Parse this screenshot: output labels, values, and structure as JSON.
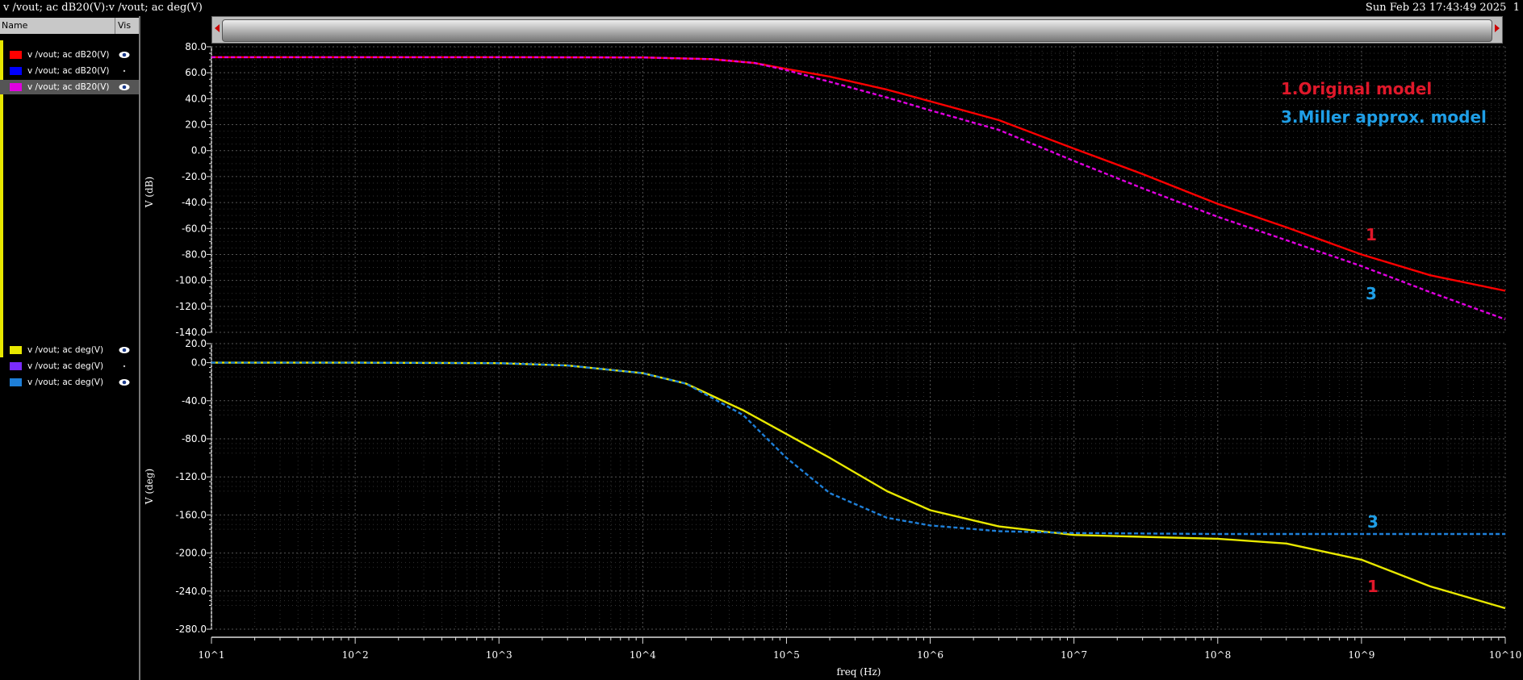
{
  "window": {
    "title": "v /vout; ac dB20(V):v /vout; ac deg(V)",
    "timestamp": "Sun Feb 23 17:43:49 2025",
    "window_number": "1"
  },
  "legend_pane": {
    "header_name": "Name",
    "header_vis": "Vis",
    "top_signals": [
      {
        "label": "v /vout; ac dB20(V)",
        "color": "#ff0000",
        "visible": true,
        "selected": false
      },
      {
        "label": "v /vout; ac dB20(V)",
        "color": "#0000ff",
        "visible": false,
        "selected": false
      },
      {
        "label": "v /vout; ac dB20(V)",
        "color": "#e000e0",
        "visible": true,
        "selected": true
      }
    ],
    "bottom_signals": [
      {
        "label": "v /vout; ac deg(V)",
        "color": "#e8e800",
        "visible": true,
        "selected": false
      },
      {
        "label": "v /vout; ac deg(V)",
        "color": "#7a2cff",
        "visible": false,
        "selected": false
      },
      {
        "label": "v /vout; ac deg(V)",
        "color": "#1e7fd8",
        "visible": true,
        "selected": false
      }
    ]
  },
  "annotations": {
    "legend_original": "1.Original model",
    "legend_miller": "3.Miller approx. model",
    "mag_label_1": "1",
    "mag_label_3": "3",
    "phase_label_3": "3",
    "phase_label_1": "1",
    "color_original": "#e0182a",
    "color_miller": "#1f9ee6"
  },
  "chart_data": [
    {
      "type": "line",
      "panel": "magnitude",
      "ylabel": "V (dB)",
      "xlabel": "freq (Hz)",
      "xscale": "log",
      "xlim": [
        10,
        10000000000
      ],
      "ylim": [
        -140,
        80
      ],
      "yticks": [
        "80.0",
        "60.0",
        "40.0",
        "20.0",
        "0.0",
        "-20.0",
        "-40.0",
        "-60.0",
        "-80.0",
        "-100.0",
        "-120.0",
        "-140.0"
      ],
      "grid": true,
      "series": [
        {
          "name": "1.Original model",
          "color": "#ff0000",
          "style": "solid",
          "x": [
            10,
            100,
            1000,
            10000,
            30000,
            60000,
            100000,
            200000,
            500000,
            1000000,
            3000000,
            10000000,
            30000000,
            100000000,
            300000000,
            1000000000,
            3000000000,
            10000000000
          ],
          "y": [
            72,
            72,
            72,
            71.8,
            70.5,
            67.5,
            63,
            57,
            47,
            38,
            23.5,
            1.5,
            -18,
            -41,
            -59,
            -80,
            -96,
            -108
          ]
        },
        {
          "name": "3.Miller approx. model",
          "color": "#e000e0",
          "style": "dashed",
          "x": [
            10,
            100,
            1000,
            10000,
            30000,
            60000,
            100000,
            200000,
            500000,
            1000000,
            3000000,
            10000000,
            30000000,
            100000000,
            300000000,
            1000000000,
            3000000000,
            10000000000
          ],
          "y": [
            72,
            72,
            72,
            71.8,
            70.5,
            67.5,
            62,
            53,
            41,
            31,
            16,
            -8,
            -29,
            -51,
            -69,
            -89,
            -109,
            -130
          ]
        }
      ]
    },
    {
      "type": "line",
      "panel": "phase",
      "ylabel": "V (deg)",
      "xlabel": "freq (Hz)",
      "xscale": "log",
      "xlim": [
        10,
        10000000000
      ],
      "ylim": [
        -280,
        20
      ],
      "yticks": [
        "20.0",
        "0.0",
        "-40.0",
        "-80.0",
        "-120.0",
        "-160.0",
        "-200.0",
        "-240.0",
        "-280.0"
      ],
      "xticks": [
        "10^1",
        "10^2",
        "10^3",
        "10^4",
        "10^5",
        "10^6",
        "10^7",
        "10^8",
        "10^9",
        "10^10"
      ],
      "grid": true,
      "series": [
        {
          "name": "1.Original model",
          "color": "#e8e800",
          "style": "solid",
          "x": [
            10,
            100,
            1000,
            3000,
            10000,
            20000,
            50000,
            100000,
            200000,
            500000,
            1000000,
            3000000,
            10000000,
            30000000,
            100000000,
            300000000,
            1000000000,
            3000000000,
            10000000000
          ],
          "y": [
            0,
            0,
            -0.5,
            -3,
            -11,
            -22,
            -50,
            -75,
            -100,
            -135,
            -155,
            -172,
            -181,
            -183,
            -185,
            -190,
            -207,
            -235,
            -258
          ]
        },
        {
          "name": "3.Miller approx. model",
          "color": "#1e7fd8",
          "style": "dashed",
          "x": [
            10,
            100,
            1000,
            3000,
            10000,
            20000,
            50000,
            100000,
            200000,
            500000,
            1000000,
            3000000,
            10000000,
            100000000,
            1000000000,
            10000000000
          ],
          "y": [
            0,
            0,
            -0.5,
            -3,
            -11,
            -22,
            -55,
            -100,
            -137,
            -163,
            -171,
            -177,
            -179,
            -180,
            -180,
            -180
          ]
        }
      ]
    }
  ]
}
